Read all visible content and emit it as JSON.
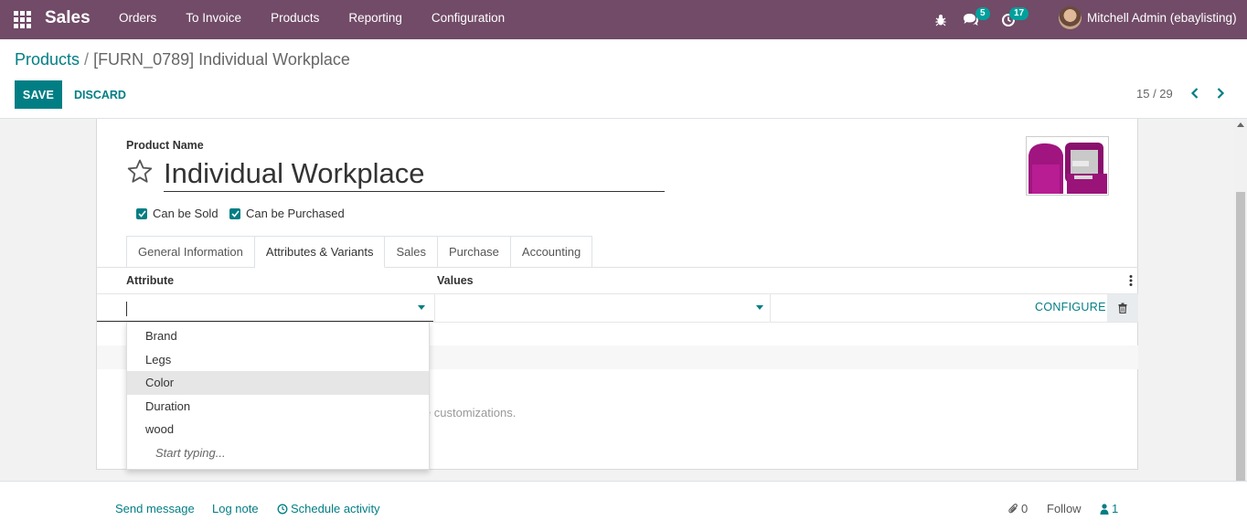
{
  "navbar": {
    "app_name": "Sales",
    "menu": [
      "Orders",
      "To Invoice",
      "Products",
      "Reporting",
      "Configuration"
    ],
    "messages_count": "5",
    "activities_count": "17",
    "user": "Mitchell Admin (ebaylisting)",
    "icons": [
      "apps-grid-icon",
      "bug-icon",
      "chat-icon",
      "activity-clock-icon"
    ]
  },
  "breadcrumb": {
    "parent": "Products",
    "separator": "/",
    "current": "[FURN_0789] Individual Workplace"
  },
  "actions": {
    "save": "SAVE",
    "discard": "DISCARD"
  },
  "pager": {
    "value": "15 / 29"
  },
  "form": {
    "name_label": "Product Name",
    "name_value": "Individual Workplace",
    "can_be_sold": {
      "label": "Can be Sold",
      "checked": true
    },
    "can_be_purchased": {
      "label": "Can be Purchased",
      "checked": true
    },
    "tabs": [
      "General Information",
      "Attributes & Variants",
      "Sales",
      "Purchase",
      "Accounting"
    ],
    "active_tab": "Attributes & Variants"
  },
  "variants_table": {
    "headers": {
      "attribute": "Attribute",
      "values": "Values"
    },
    "configure_label": "CONFIGURE",
    "warning_text": "eate existing variants and lead to the loss of their possible customizations."
  },
  "attribute_dropdown": {
    "options": [
      "Brand",
      "Legs",
      "Color",
      "Duration",
      "wood"
    ],
    "highlighted": "Color",
    "hint": "Start typing..."
  },
  "chatter": {
    "send_message": "Send message",
    "log_note": "Log note",
    "schedule_activity": "Schedule activity",
    "attachments": "0",
    "follow": "Follow",
    "followers": "1"
  },
  "colors": {
    "navbar": "#714b67",
    "accent": "#017e84",
    "badge": "#00a09d",
    "product_color": "#a0157f"
  }
}
